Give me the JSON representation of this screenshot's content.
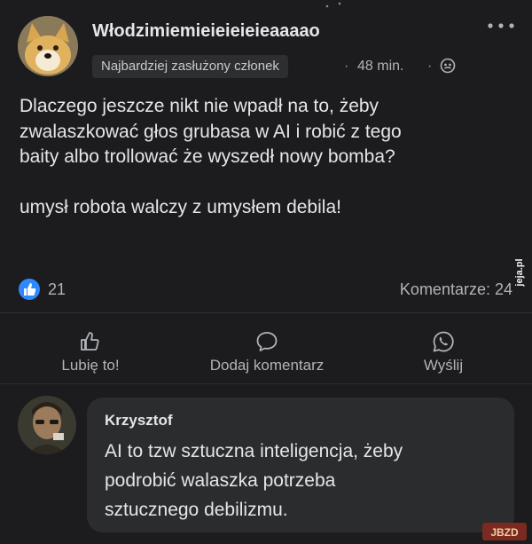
{
  "post": {
    "author_name": "Włodzimiemieieieieieaaaao",
    "badge": "Najbardziej zasłużony członek",
    "separator": "·",
    "time": "48 min.",
    "body_line1": "Dlaczego jeszcze nikt nie wpadł na to, żeby",
    "body_line2": "zwalaszkować głos grubasa w AI i robić z tego",
    "body_line3": "baity albo trollować że wyszedł nowy bomba?",
    "body_line4": "umysł robota walczy z umysłem debila!",
    "like_count": "21",
    "comments_count": "Komentarze: 24"
  },
  "actions": {
    "like_label": "Lubię to!",
    "comment_label": "Dodaj komentarz",
    "send_label": "Wyślij"
  },
  "comment": {
    "author": "Krzysztof",
    "line1": "AI to tzw sztuczna inteligencja, żeby",
    "line2": "podrobić walaszka potrzeba",
    "line3": "sztucznego debilizmu."
  },
  "watermarks": {
    "jeja": "jeja.pl",
    "jbzd": "JBZD"
  },
  "colors": {
    "background": "#1c1c1e",
    "bubble": "#2b2c2e",
    "like_blue": "#2e89ff",
    "text": "#e4e6eb",
    "muted": "#b0b3b8"
  },
  "icons": [
    "dog-avatar",
    "more-icon",
    "globe-icon",
    "like-reaction-icon",
    "thumb-up-icon",
    "comment-icon",
    "whatsapp-icon",
    "man-avatar"
  ]
}
